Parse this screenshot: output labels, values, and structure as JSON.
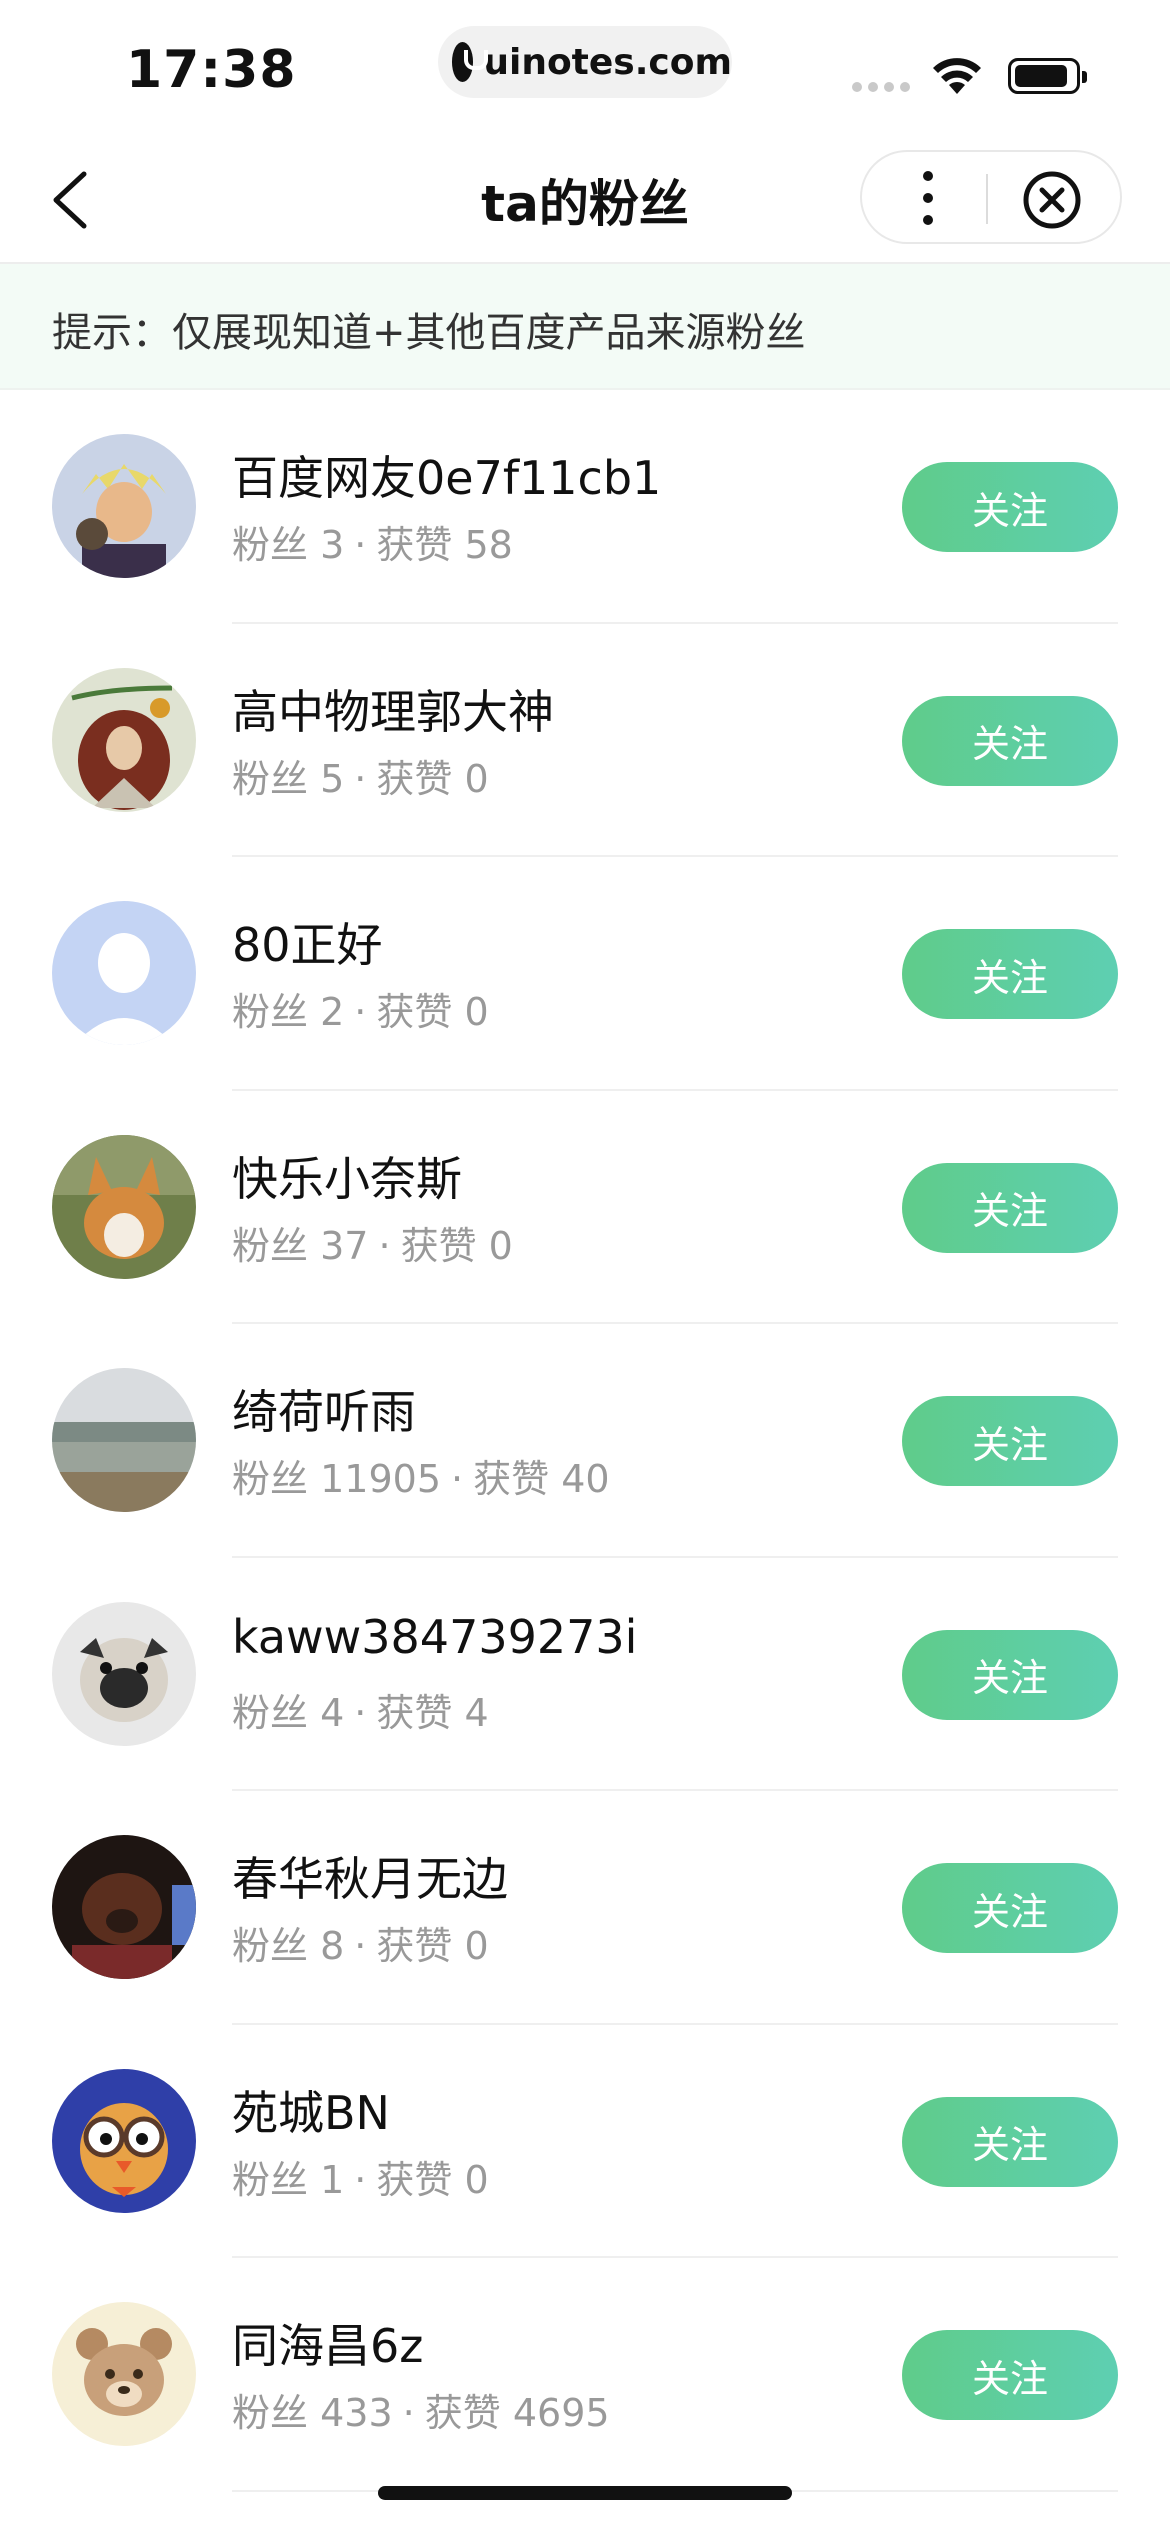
{
  "status_bar": {
    "time": "17:38",
    "url": "uinotes.com"
  },
  "nav": {
    "title": "ta的粉丝",
    "back_icon": "chevron-left-icon",
    "more_icon": "more-vertical-icon",
    "close_icon": "close-circle-icon"
  },
  "tip": {
    "text": "提示：仅展现知道+其他百度产品来源粉丝"
  },
  "fans_label": "粉丝",
  "likes_label": "获赞",
  "separator": "·",
  "follow_label": "关注",
  "users": [
    {
      "name": "百度网友0e7f11cb1",
      "fans": "3",
      "likes": "58",
      "avatar": "cartoon-warrior"
    },
    {
      "name": "高中物理郭大神",
      "fans": "5",
      "likes": "0",
      "avatar": "newton-portrait"
    },
    {
      "name": "80正好",
      "fans": "2",
      "likes": "0",
      "avatar": "default-avatar"
    },
    {
      "name": "快乐小奈斯",
      "fans": "37",
      "likes": "0",
      "avatar": "corgi-dog"
    },
    {
      "name": "绮荷听雨",
      "fans": "11905",
      "likes": "40",
      "avatar": "landscape"
    },
    {
      "name": "kaww384739273i",
      "fans": "4",
      "likes": "4",
      "avatar": "pug-dog"
    },
    {
      "name": "春华秋月无边",
      "fans": "8",
      "likes": "0",
      "avatar": "brown-dog"
    },
    {
      "name": "苑城BN",
      "fans": "1",
      "likes": "0",
      "avatar": "owl-cartoon"
    },
    {
      "name": "同海昌6z",
      "fans": "433",
      "likes": "4695",
      "avatar": "bear-cartoon"
    }
  ]
}
